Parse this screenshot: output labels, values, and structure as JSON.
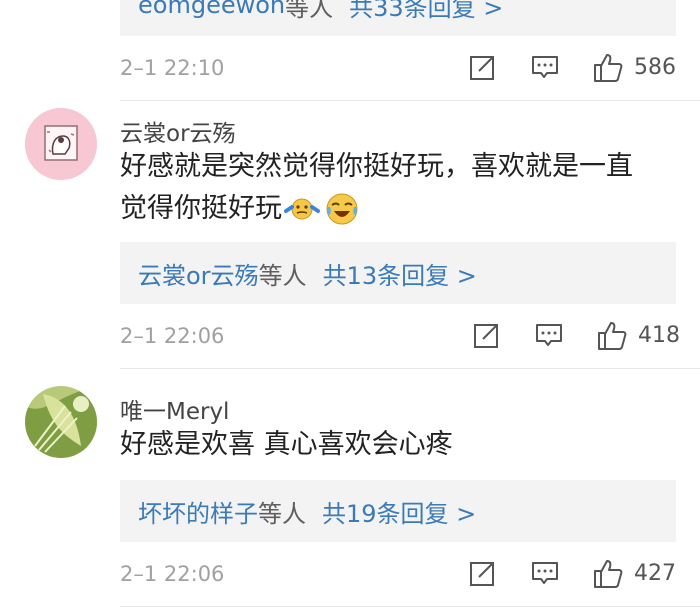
{
  "comments": [
    {
      "reply": {
        "names": "eomgeewon",
        "suffix": "等人",
        "count": "共33条回复 >"
      },
      "time": "2–1 22:10",
      "likes": "586"
    },
    {
      "username": "云裳or云殇",
      "text_line1": "好感就是突然觉得你挺好玩，喜欢就是一直",
      "text_line2": "觉得你挺好玩",
      "reply": {
        "names": "云裳or云殇",
        "suffix": "等人",
        "count": "共13条回复 >"
      },
      "time": "2–1 22:06",
      "likes": "418"
    },
    {
      "username": "唯一Meryl",
      "text_line1": "好感是欢喜 真心喜欢会心疼",
      "reply": {
        "names": "坏坏的样子",
        "suffix": "等人",
        "count": "共19条回复 >"
      },
      "time": "2–1 22:06",
      "likes": "427"
    }
  ],
  "colors": {
    "link": "#3a7ab8",
    "background": "#ffffff",
    "reply_bg": "#f3f3f3"
  },
  "icons": [
    "share-icon",
    "comment-icon",
    "like-icon",
    "shrug-emoji",
    "laugh-cry-emoji"
  ]
}
